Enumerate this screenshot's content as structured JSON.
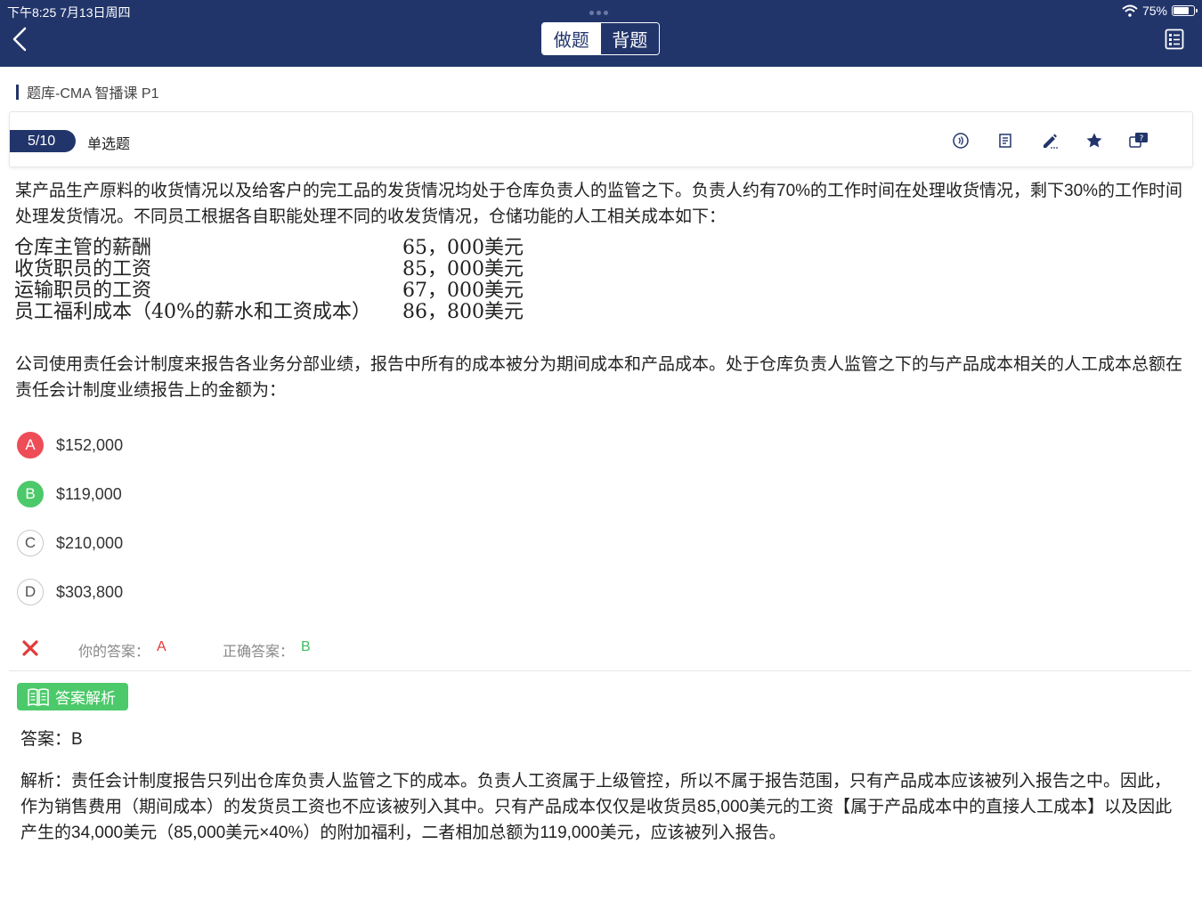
{
  "status_bar": {
    "time": "下午8:25   7月13日周四",
    "battery": "75%",
    "battery_level": 0.75
  },
  "header": {
    "mode_tabs": [
      {
        "label": "做题",
        "active": true
      },
      {
        "label": "背题",
        "active": false
      }
    ]
  },
  "breadcrumb": "题库-CMA 智播课 P1",
  "question_bar": {
    "progress": "5/10",
    "type": "单选题",
    "tools": [
      "audio-icon",
      "note-icon",
      "edit-icon",
      "star-icon",
      "question-help-icon"
    ]
  },
  "question": {
    "intro": "某产品生产原料的收货情况以及给客户的完工品的发货情况均处于仓库负责人的监管之下。负责人约有70%的工作时间在处理收货情况，剩下30%的工作时间处理发货情况。不同员工根据各自职能处理不同的收发货情况，仓储功能的人工相关成本如下：",
    "costs": [
      {
        "item": "仓库主管的薪酬",
        "amount": "65，000美元"
      },
      {
        "item": "收货职员的工资",
        "amount": "85，000美元"
      },
      {
        "item": "运输职员的工资",
        "amount": "67，000美元"
      },
      {
        "item": "员工福利成本（40%的薪水和工资成本）",
        "amount": "86，800美元"
      }
    ],
    "body": "公司使用责任会计制度来报告各业务分部业绩，报告中所有的成本被分为期间成本和产品成本。处于仓库负责人监管之下的与产品成本相关的人工成本总额在责任会计制度业绩报告上的金额为："
  },
  "options": [
    {
      "letter": "A",
      "text": "$152,000",
      "state": "wrong"
    },
    {
      "letter": "B",
      "text": "$119,000",
      "state": "right"
    },
    {
      "letter": "C",
      "text": "$210,000",
      "state": "plain"
    },
    {
      "letter": "D",
      "text": "$303,800",
      "state": "plain"
    }
  ],
  "result": {
    "your_answer_label": "你的答案：",
    "your_answer": "A",
    "correct_answer_label": "正确答案：",
    "correct_answer": "B"
  },
  "analysis": {
    "tag": "答案解析",
    "answer": "答案：B",
    "explanation": "解析：责任会计制度报告只列出仓库负责人监管之下的成本。负责人工资属于上级管控，所以不属于报告范围，只有产品成本应该被列入报告之中。因此，作为销售费用（期间成本）的发货员工资也不应该被列入其中。只有产品成本仅仅是收货员85,000美元的工资【属于产品成本中的直接人工成本】以及因此产生的34,000美元（85,000美元×40%）的附加福利，二者相加总额为119,000美元，应该被列入报告。"
  },
  "colors": {
    "navy": "#22356b",
    "green": "#4cc96a",
    "red": "#ee4d57"
  }
}
